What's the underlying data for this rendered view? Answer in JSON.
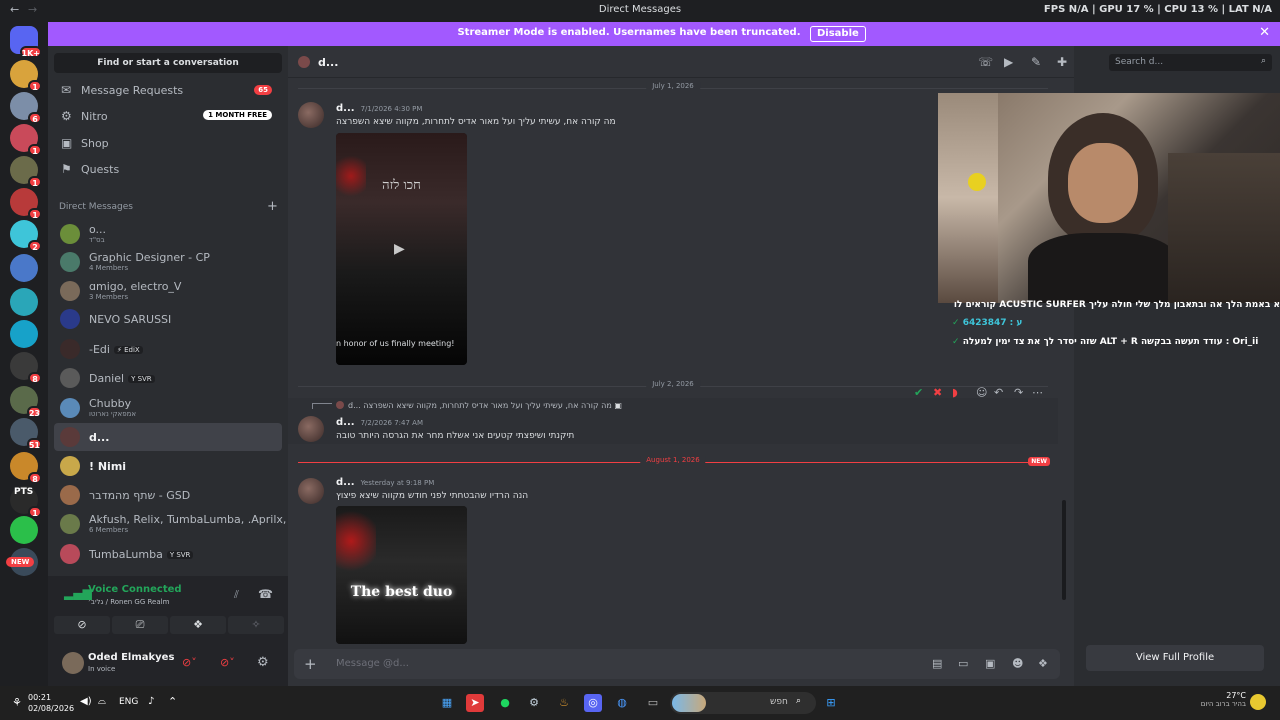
{
  "titlebar": {
    "title": "Direct Messages",
    "back": "←",
    "forward": "→",
    "stats": "FPS N/A | GPU 17 % | CPU 13 % | LAT N/A"
  },
  "banner": {
    "text": "Streamer Mode is enabled. Usernames have been truncated.",
    "button": "Disable",
    "close": "✕"
  },
  "servers": [
    {
      "color": "#5865f2",
      "badge": "1K+"
    },
    {
      "color": "#d9a33c",
      "badge": "1"
    },
    {
      "color": "#7c8ea8",
      "badge": "6"
    },
    {
      "color": "#c94a5a",
      "badge": "1"
    },
    {
      "color": "#6b6b4a",
      "badge": "1"
    },
    {
      "color": "#b83a3a",
      "badge": "1"
    },
    {
      "color": "#3ec5d9",
      "badge": "2"
    },
    {
      "color": "#4a78c9",
      "badge": ""
    },
    {
      "color": "#2aa6b8",
      "badge": ""
    },
    {
      "color": "#17a2c9",
      "badge": ""
    },
    {
      "color": "#3a3a3a",
      "badge": "8"
    },
    {
      "color": "#5a6a4a",
      "badge": "23"
    },
    {
      "color": "#4a5a6a",
      "badge": "51"
    },
    {
      "color": "#c9882a",
      "badge": "8"
    },
    {
      "color": "#2a2a2a",
      "badge": "1"
    },
    {
      "color": "#2bbf4a",
      "badge": ""
    },
    {
      "color": "#3a4a5a",
      "badge": ""
    }
  ],
  "servers_extra": {
    "pts": "PTS",
    "new": "NEW"
  },
  "sidebar": {
    "search": "Find or start a conversation",
    "nav": [
      {
        "icon": "✉",
        "label": "Message Requests",
        "pill": "65",
        "free": ""
      },
      {
        "icon": "⚙",
        "label": "Nitro",
        "pill": "",
        "free": "1 MONTH FREE"
      },
      {
        "icon": "▣",
        "label": "Shop",
        "pill": "",
        "free": ""
      },
      {
        "icon": "⚑",
        "label": "Quests",
        "pill": "",
        "free": ""
      }
    ],
    "dm_header": "Direct Messages",
    "dm_plus": "+",
    "dms": [
      {
        "name": "o...",
        "sub": "בס\"ד",
        "tag": "",
        "color": "#6b8e3a"
      },
      {
        "name": "Graphic Designer - CP",
        "sub": "4 Members",
        "tag": "",
        "color": "#4a7a6a"
      },
      {
        "name": "ɑmigo, electro_V",
        "sub": "3 Members",
        "tag": "",
        "color": "#7a6a5a"
      },
      {
        "name": "NEVO SARUSSI",
        "sub": "",
        "tag": "",
        "color": "#2a3a8a"
      },
      {
        "name": "-Edi",
        "sub": "",
        "tag": "⚡ EdiX",
        "color": "#3a2a2a"
      },
      {
        "name": "Daniel",
        "sub": "",
        "tag": "Y SVR",
        "color": "#5a5a5a"
      },
      {
        "name": "Chubby",
        "sub": "אמפאקי נארוטו",
        "tag": "",
        "color": "#5a8ab8"
      },
      {
        "name": "d...",
        "sub": "",
        "tag": "",
        "color": "#5a3a3a"
      },
      {
        "name": "! Nimi",
        "sub": "",
        "tag": "",
        "color": "#c8a84a"
      },
      {
        "name": "שתף מהמדבר - GSD",
        "sub": "",
        "tag": "",
        "color": "#9a6a4a"
      },
      {
        "name": "Akfush, Relix, TumbaLumba, .Aprilx, S...",
        "sub": "6 Members",
        "tag": "",
        "color": "#6a7a4a"
      },
      {
        "name": "TumbaLumba",
        "sub": "",
        "tag": "Y SVR",
        "color": "#b84a5a"
      }
    ],
    "voice": {
      "status": "Voice Connected",
      "channel": "גליב׳ / Ronen GG Realm"
    },
    "user": {
      "name": "Oded Elmakyes",
      "status": "In voice"
    }
  },
  "main": {
    "channel": "d...",
    "search_placeholder": "Search d...",
    "dividers": [
      "July 1, 2026",
      "July 2, 2026",
      "August 1, 2026"
    ],
    "new_badge": "NEW",
    "messages": [
      {
        "author": "d...",
        "time": "7/1/2026 4:30 PM",
        "text": "מה קורה אח, עשיתי עליך ועל מאור אדיס לתחרות, מקווה שיצא השפרצה",
        "video_caption": "n honor of us finally meeting!",
        "video_title": "חכו לזה"
      },
      {
        "author": "d...",
        "time": "7/2/2026 7:47 AM",
        "text": "תיקנתי ושיפצתי קטעים אני אשלח מחר את הגרסה היותר טובה",
        "reply_author": "d...",
        "reply_text": "מה קורה אח, עשיתי עליך ועל מאור אדיס לתחרות, מקווה שיצא השפרצה"
      },
      {
        "author": "d...",
        "time": "Yesterday at 9:18 PM",
        "text": "הנה הרדיו שהבטחתי לפני חודש מקווה שיצא פיצוץ",
        "video_caption": "The best duo"
      }
    ],
    "composer_placeholder": "Message @d..."
  },
  "overlay_chat": [
    {
      "text": "א באמת הלך אה ובתאבון מלך שלי חולה עליך ACUSTIC SURFER קוראים לו",
      "color": "#ffffff"
    },
    {
      "text": "ע : 6423847",
      "color": "#ffffff",
      "user": "6423847"
    },
    {
      "text": "שזה יסדר לך את צד ימין למעלה ALT + R עודד תעשה בבקשה : Ori_ii",
      "color": "#ffffff",
      "user": "Ori_ii"
    }
  ],
  "profile": {
    "view_button": "View Full Profile"
  },
  "taskbar": {
    "time": "00:21",
    "date": "02/08/2026",
    "lang": "ENG",
    "search": "חפש",
    "weather_temp": "27°C",
    "weather_desc": "בהיר ברוב היום",
    "notif": "5"
  }
}
